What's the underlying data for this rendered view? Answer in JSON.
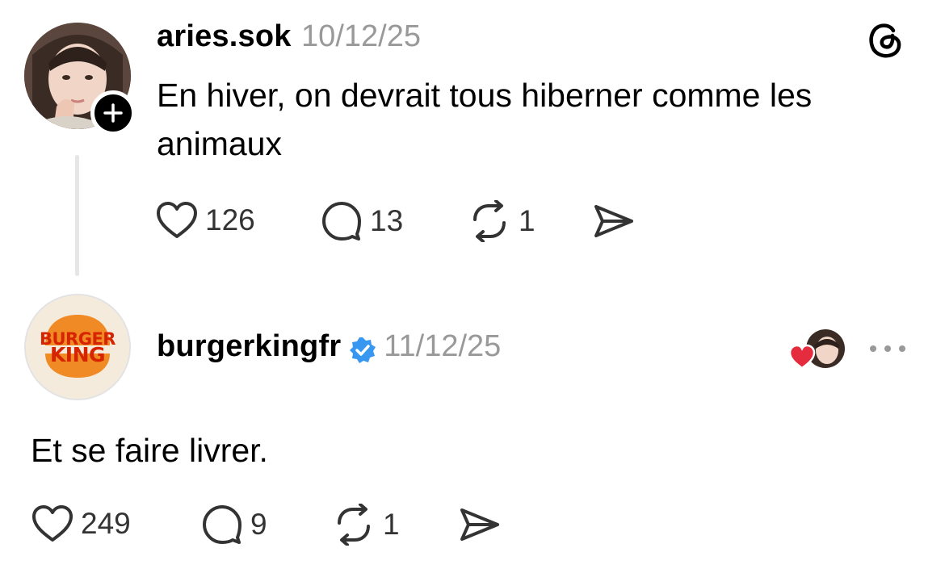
{
  "post1": {
    "username": "aries.sok",
    "date": "10/12/25",
    "text": "En hiver, on devrait tous hiberner comme les animaux",
    "likes": "126",
    "replies": "13",
    "reposts": "1"
  },
  "post2": {
    "username": "burgerkingfr",
    "date": "11/12/25",
    "text": "Et se faire livrer.",
    "likes": "249",
    "replies": "9",
    "reposts": "1",
    "logo_line1": "BURGER",
    "logo_line2": "KING"
  },
  "icons": {
    "app_logo": "threads-logo-icon",
    "verified": "verified-badge-icon",
    "like": "heart-icon",
    "reply": "comment-icon",
    "repost": "repost-icon",
    "share": "send-icon",
    "more": "more-options-icon"
  },
  "colors": {
    "verified_blue": "#3897f0",
    "heart_red": "#e52b3e",
    "bk_orange": "#f08a24",
    "bk_red": "#d62300",
    "muted": "#999999"
  }
}
